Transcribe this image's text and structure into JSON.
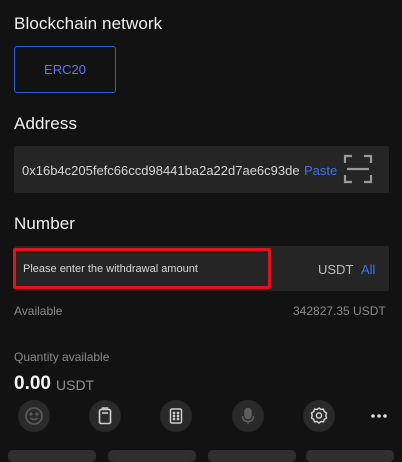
{
  "network": {
    "title": "Blockchain network",
    "selected": "ERC20"
  },
  "address": {
    "title": "Address",
    "value": "0x16b4c205fefc66ccd98441ba2a22d7ae6c93de",
    "paste_label": "Paste",
    "scan_icon": "scan-qr-icon"
  },
  "number": {
    "title": "Number",
    "placeholder": "Please enter the withdrawal amount",
    "unit": "USDT",
    "all_label": "All"
  },
  "available": {
    "label": "Available",
    "value": "342827.35 USDT"
  },
  "quantity": {
    "label": "Quantity available",
    "value": "0.00",
    "unit": "USDT"
  },
  "keyboard_toolbar": {
    "icons": [
      "emoji-icon",
      "clipboard-icon",
      "keypad-icon",
      "microphone-icon",
      "settings-icon",
      "more-icon"
    ]
  },
  "colors": {
    "background": "#121212",
    "field": "#252525",
    "accent": "#3f72e9",
    "highlight": "#e0141a"
  }
}
